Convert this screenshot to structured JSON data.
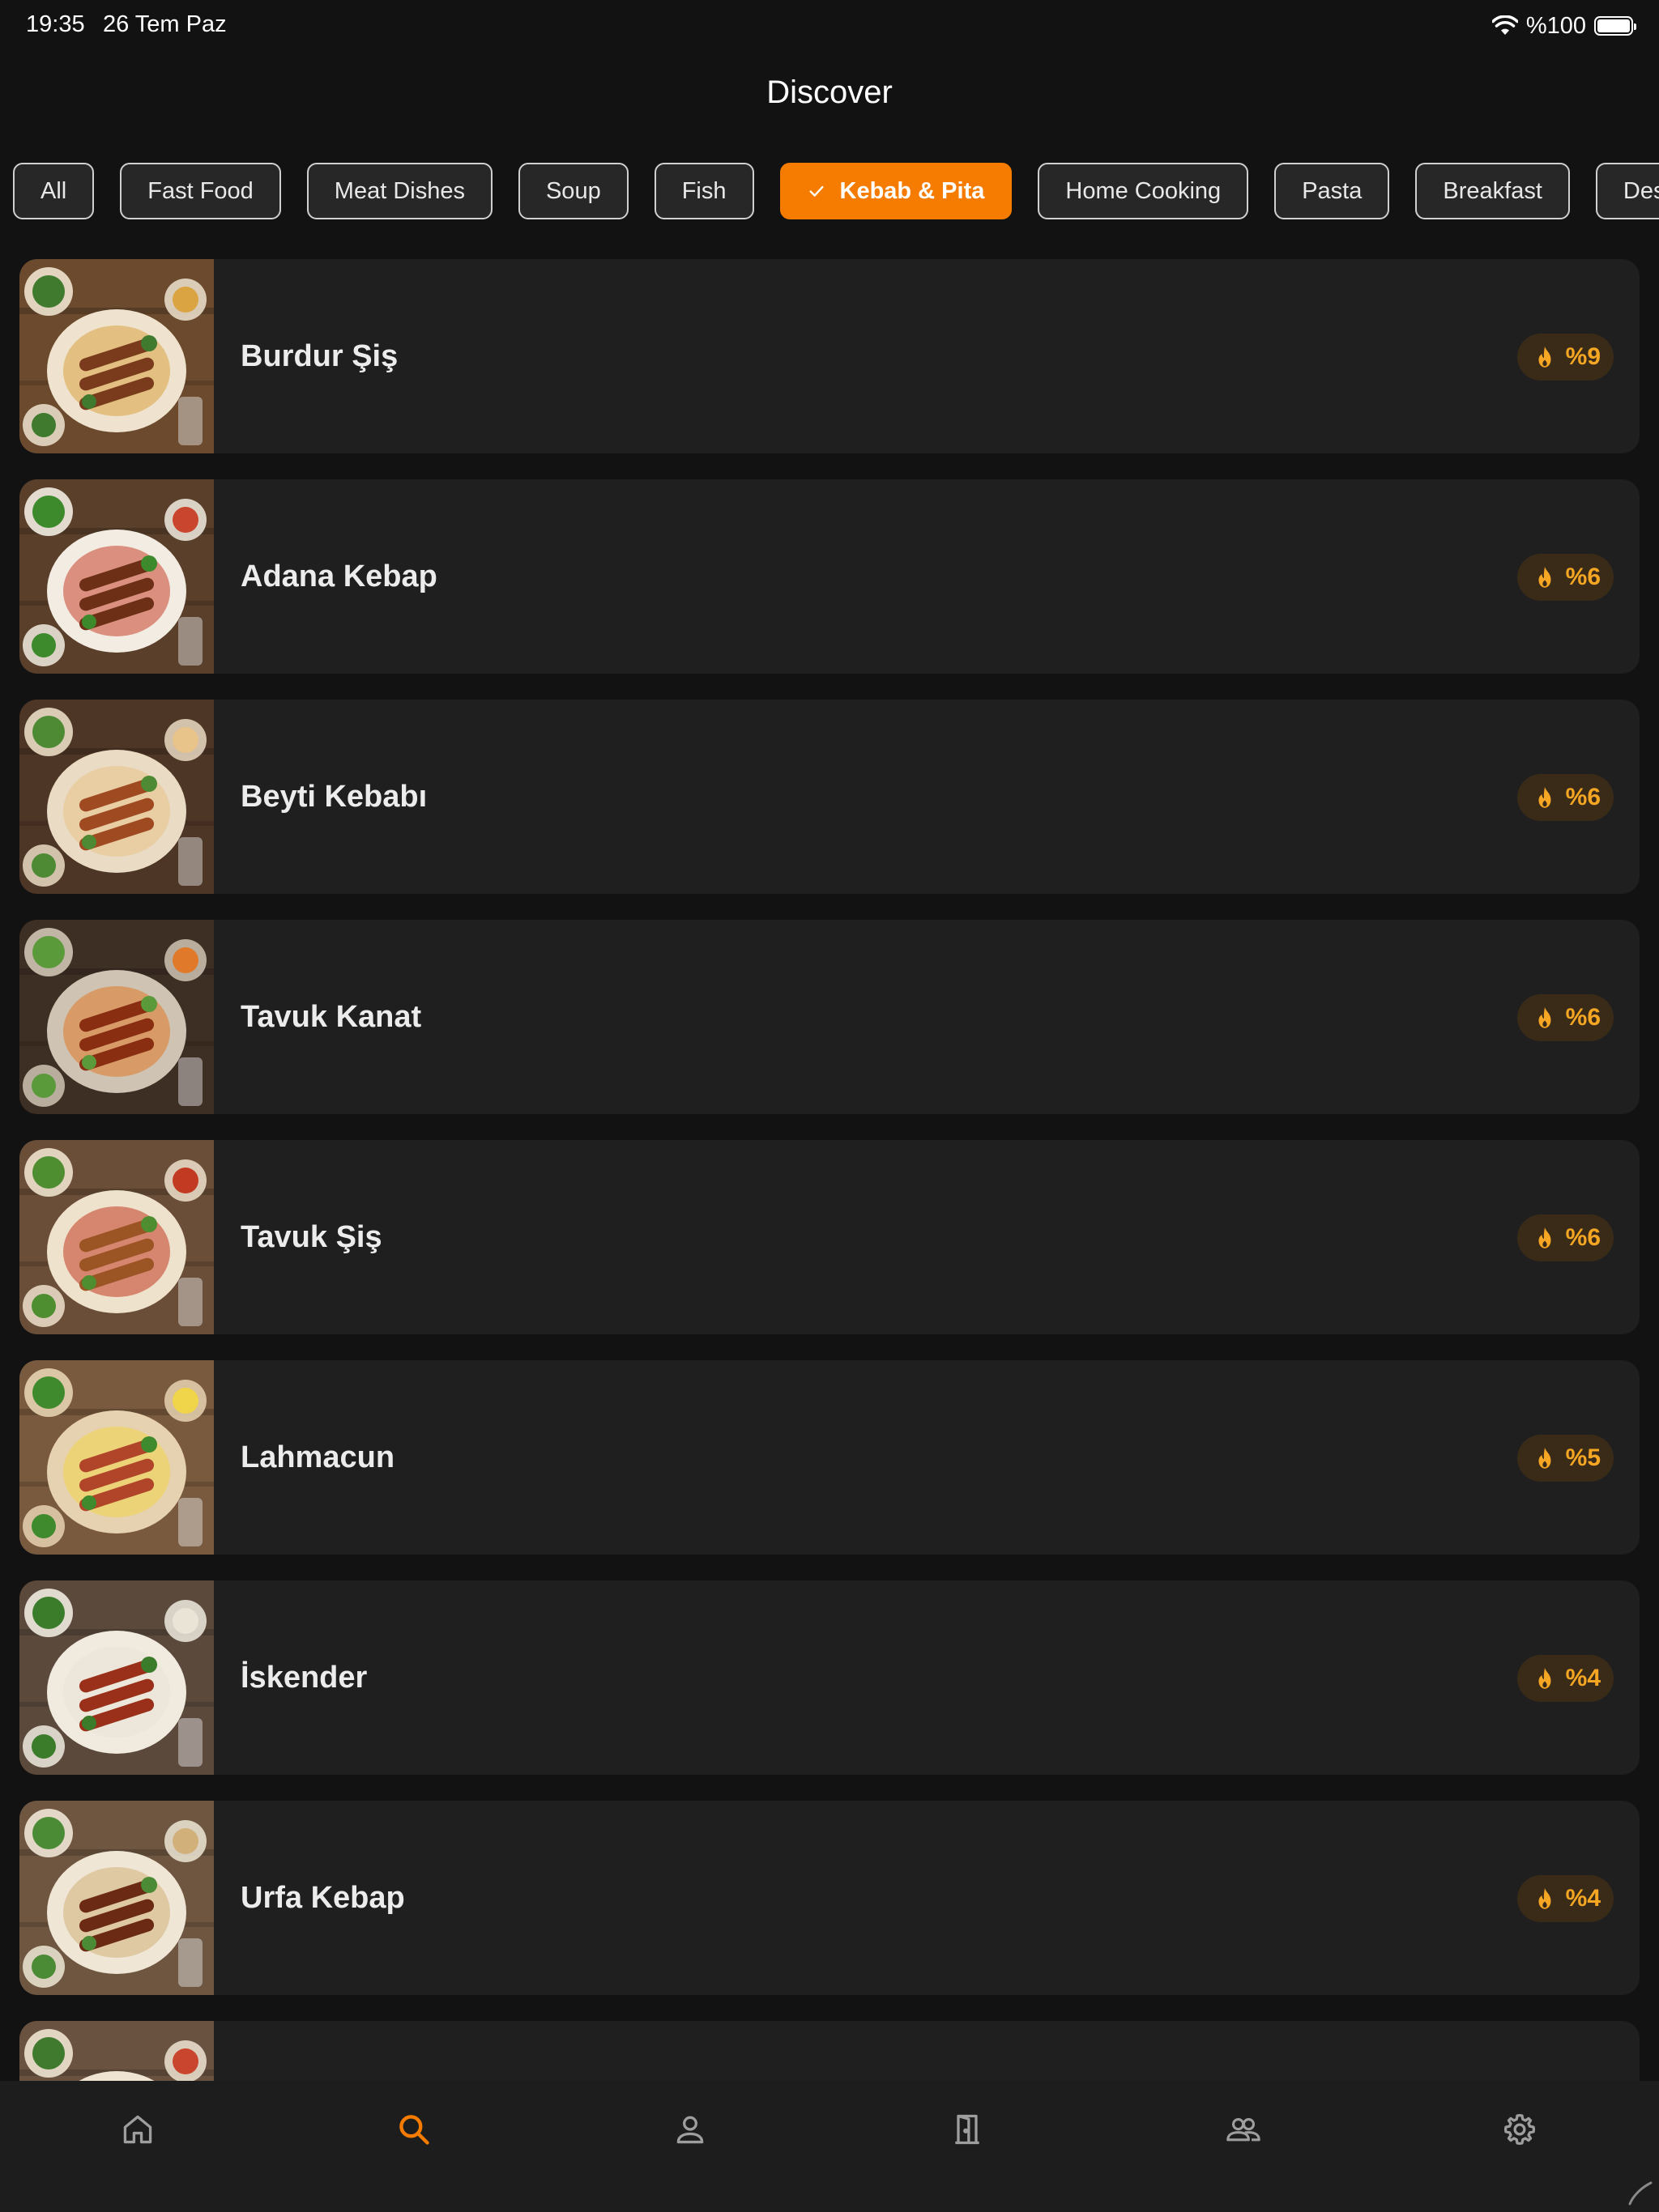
{
  "status_bar": {
    "time": "19:35",
    "date": "26 Tem Paz",
    "battery_label": "%100",
    "battery_level": 1.0
  },
  "header": {
    "title": "Discover"
  },
  "filters": {
    "chips": [
      {
        "label": "All",
        "selected": false
      },
      {
        "label": "Fast Food",
        "selected": false
      },
      {
        "label": "Meat Dishes",
        "selected": false
      },
      {
        "label": "Soup",
        "selected": false
      },
      {
        "label": "Fish",
        "selected": false
      },
      {
        "label": "Kebab & Pita",
        "selected": true
      },
      {
        "label": "Home Cooking",
        "selected": false
      },
      {
        "label": "Pasta",
        "selected": false
      },
      {
        "label": "Breakfast",
        "selected": false
      },
      {
        "label": "Des",
        "selected": false
      }
    ]
  },
  "dishes": [
    {
      "name": "Burdur Şiş",
      "popularity": "%9"
    },
    {
      "name": "Adana Kebap",
      "popularity": "%6"
    },
    {
      "name": "Beyti Kebabı",
      "popularity": "%6"
    },
    {
      "name": "Tavuk Kanat",
      "popularity": "%6"
    },
    {
      "name": "Tavuk Şiş",
      "popularity": "%6"
    },
    {
      "name": "Lahmacun",
      "popularity": "%5"
    },
    {
      "name": "İskender",
      "popularity": "%4"
    },
    {
      "name": "Urfa Kebap",
      "popularity": "%4"
    },
    {
      "name": "",
      "popularity": ""
    }
  ],
  "bottom_nav": {
    "items": [
      {
        "icon": "home-icon",
        "active": false
      },
      {
        "icon": "search-icon",
        "active": true
      },
      {
        "icon": "person-icon",
        "active": false
      },
      {
        "icon": "door-icon",
        "active": false
      },
      {
        "icon": "group-icon",
        "active": false
      },
      {
        "icon": "settings-icon",
        "active": false
      }
    ]
  },
  "colors": {
    "background": "#121212",
    "card": "#1f1f1f",
    "accent": "#f57c00",
    "badge_text": "#f5a623",
    "badge_bg": "#3a2a18",
    "nav_inactive": "#9e9e9e"
  }
}
